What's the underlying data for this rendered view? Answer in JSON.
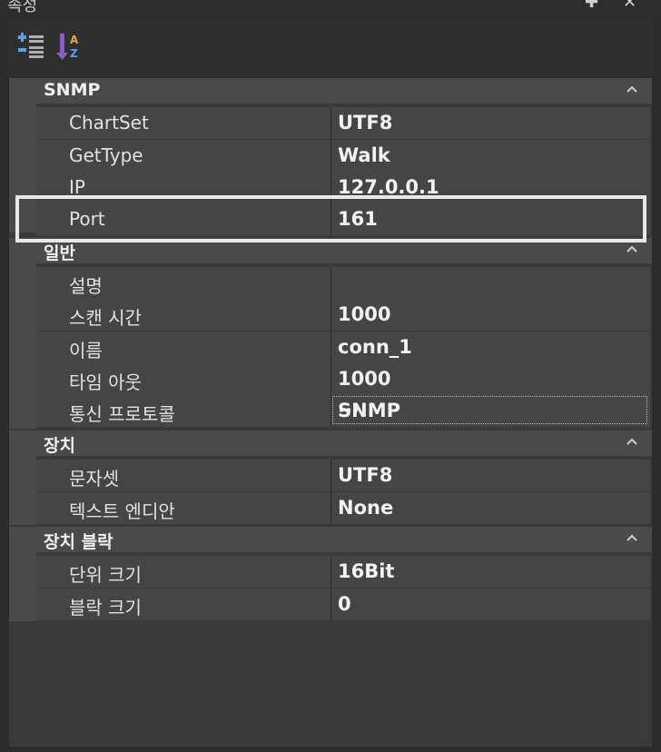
{
  "window": {
    "title": "속성",
    "pin_glyph": "✚",
    "close_glyph": "✕"
  },
  "toolbar": {
    "categorized_icon": "categorized-view-icon",
    "alphabetical_icon": "alphabetical-sort-icon"
  },
  "sections": [
    {
      "title": "SNMP",
      "rows": [
        {
          "name": "ChartSet",
          "value": "UTF8"
        },
        {
          "name": "GetType",
          "value": "Walk"
        },
        {
          "name": "IP",
          "value": "127.0.0.1"
        },
        {
          "name": "Port",
          "value": "161"
        }
      ]
    },
    {
      "title": "일반",
      "rows": [
        {
          "name": "설명",
          "value": ""
        },
        {
          "name": "스캔 시간",
          "value": "1000"
        },
        {
          "name": "이름",
          "value": "conn_1"
        },
        {
          "name": "타임 아웃",
          "value": "1000"
        },
        {
          "name": "통신 프로토콜",
          "value": "SNMP",
          "ellipsis": "···"
        }
      ]
    },
    {
      "title": "장치",
      "rows": [
        {
          "name": "문자셋",
          "value": "UTF8"
        },
        {
          "name": "텍스트 엔디안",
          "value": "None"
        }
      ]
    },
    {
      "title": "장치 블락",
      "rows": [
        {
          "name": "단위 크기",
          "value": "16Bit"
        },
        {
          "name": "블락 크기",
          "value": "0"
        }
      ]
    }
  ],
  "colors": {
    "background": "#2b2b2b",
    "grid": "#3a3a3a",
    "header": "#4a4a4a",
    "cell": "#454545",
    "highlight": "#e8e8e8"
  }
}
